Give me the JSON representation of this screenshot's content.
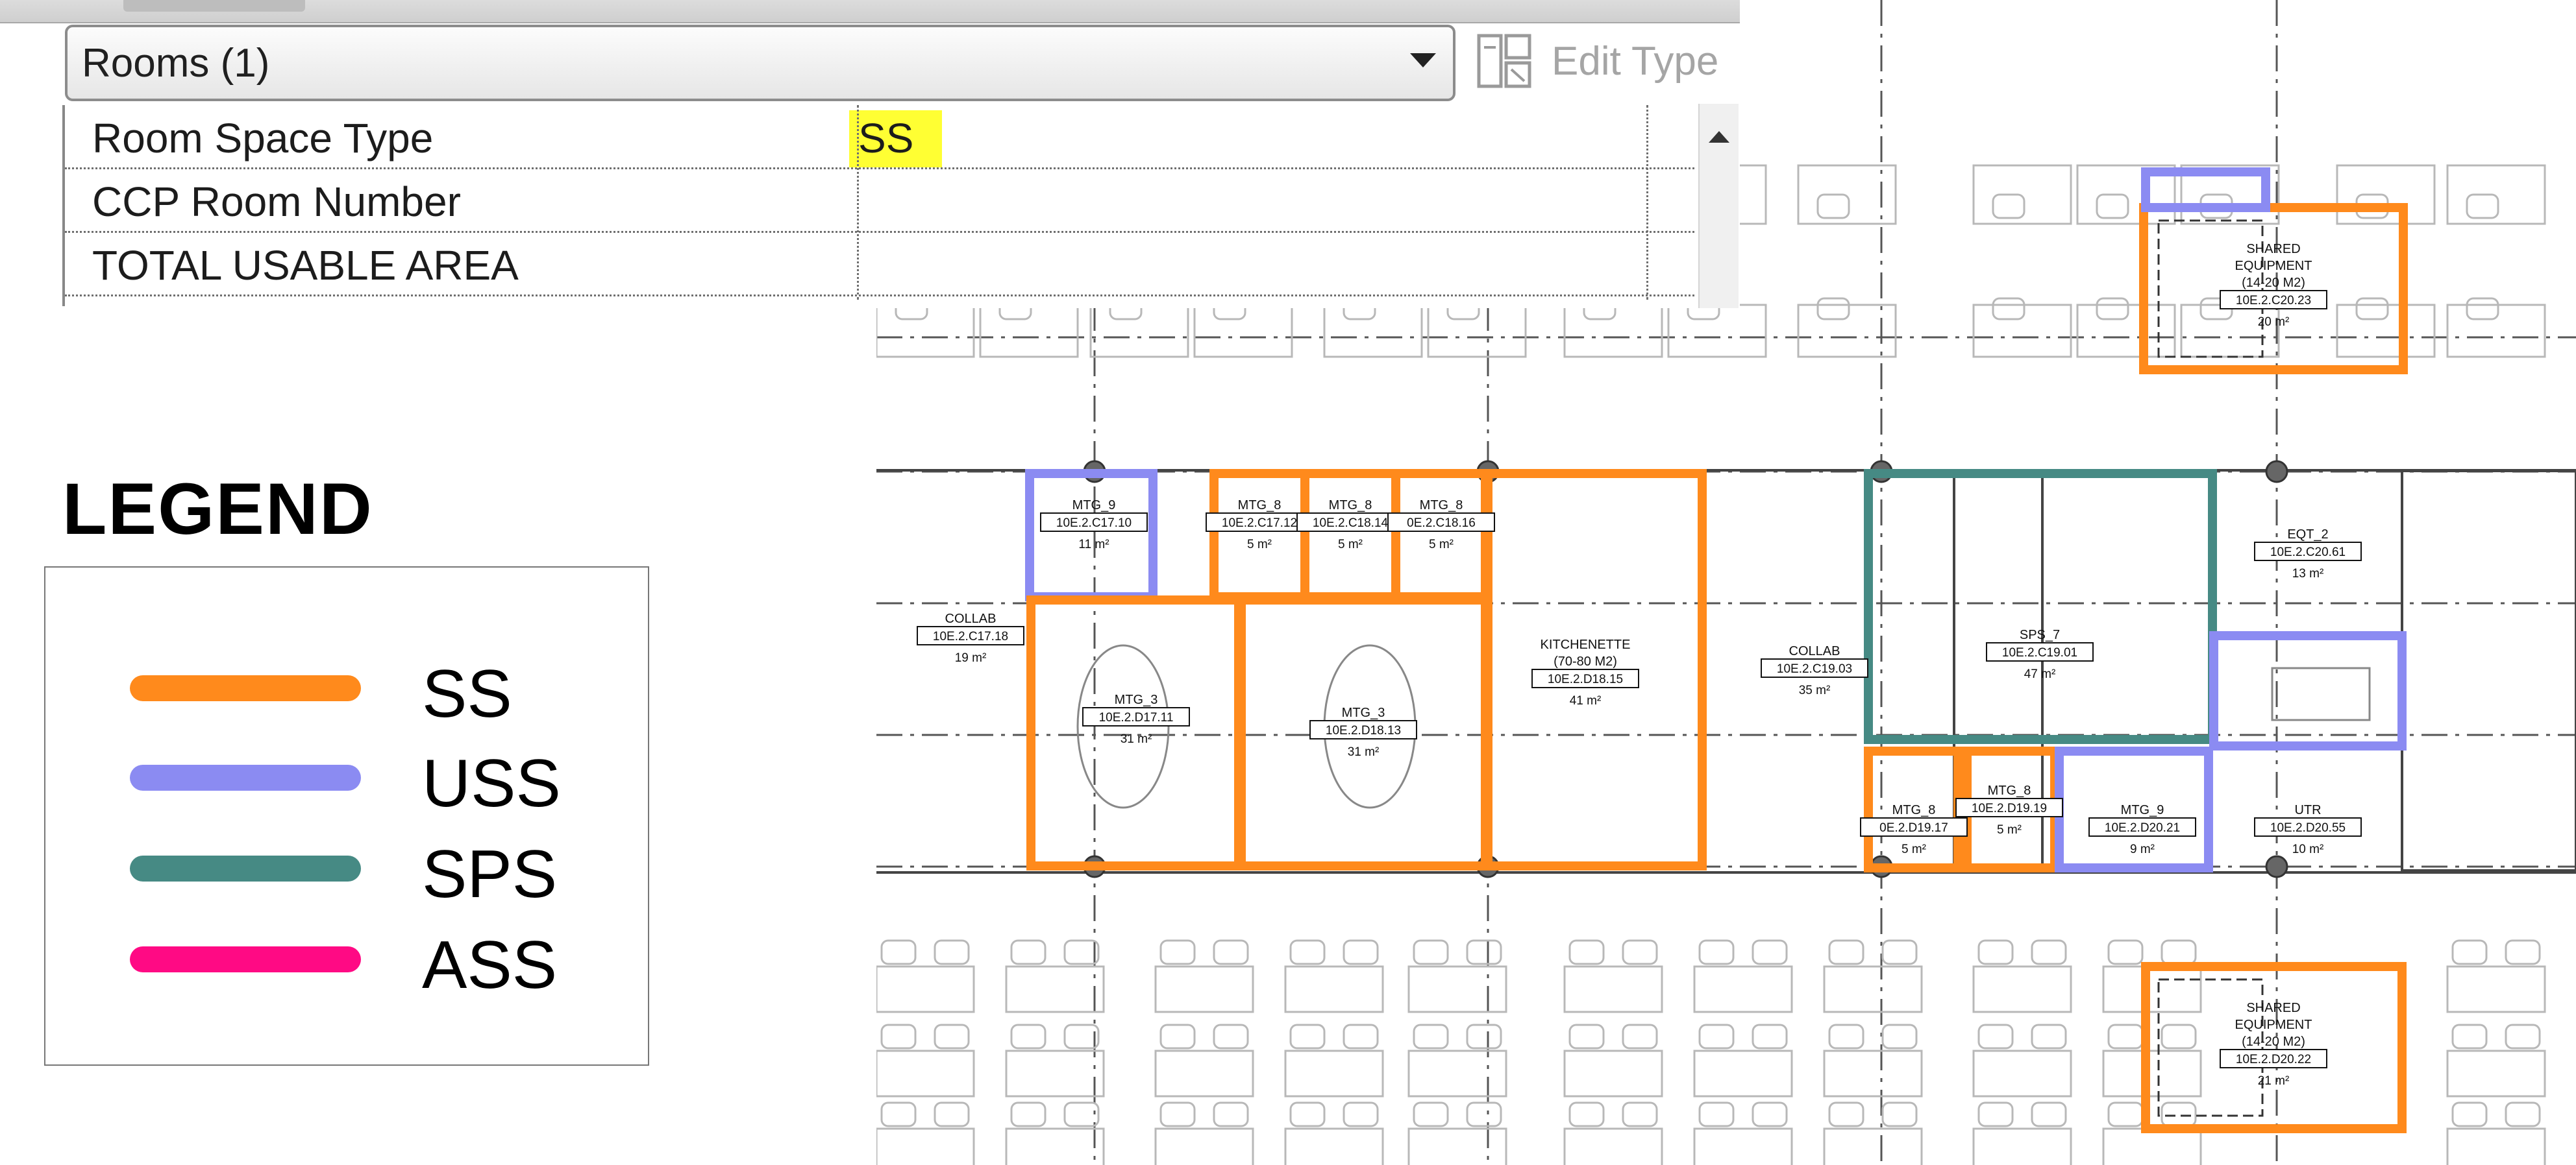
{
  "properties": {
    "type_selector": "Rooms (1)",
    "edit_type": "Edit Type",
    "rows": [
      {
        "name": "Room Space Type",
        "value": "SS"
      },
      {
        "name": "CCP Room Number",
        "value": ""
      },
      {
        "name": "TOTAL USABLE AREA",
        "value": ""
      }
    ]
  },
  "legend": {
    "title": "LEGEND",
    "items": [
      {
        "label": "SS",
        "color": "#ff8a1c"
      },
      {
        "label": "USS",
        "color": "#8b8bf2"
      },
      {
        "label": "SPS",
        "color": "#468a84"
      },
      {
        "label": "ASS",
        "color": "#ff0a84"
      }
    ]
  },
  "plan": {
    "rooms": [
      {
        "name": "SHARED",
        "name2": "EQUIPMENT",
        "note": "(14-20 M2)",
        "number": "10E.2.C20.23",
        "area": "20 m²"
      },
      {
        "name": "MTG_9",
        "number": "10E.2.C17.10",
        "area": "11 m²"
      },
      {
        "name": "MTG_8",
        "number": "10E.2.C17.12",
        "area": "5 m²"
      },
      {
        "name": "MTG_8",
        "number": "10E.2.C18.14",
        "area": "5 m²"
      },
      {
        "name": "MTG_8",
        "number": "0E.2.C18.16",
        "area": "5 m²"
      },
      {
        "name": "COLLAB",
        "number": "10E.2.C17.18",
        "area": "19 m²"
      },
      {
        "name": "MTG_3",
        "number": "10E.2.D17.11",
        "area": "31 m²"
      },
      {
        "name": "MTG_3",
        "number": "10E.2.D18.13",
        "area": "31 m²"
      },
      {
        "name": "KITCHENETTE",
        "note": "(70-80 M2)",
        "number": "10E.2.D18.15",
        "area": "41 m²"
      },
      {
        "name": "COLLAB",
        "number": "10E.2.C19.03",
        "area": "35 m²"
      },
      {
        "name": "SPS_7",
        "number": "10E.2.C19.01",
        "area": "47 m²"
      },
      {
        "name": "EQT_2",
        "number": "10E.2.C20.61",
        "area": "13 m²"
      },
      {
        "name": "MTG_8",
        "number": "0E.2.D19.17",
        "area": "5 m²"
      },
      {
        "name": "MTG_8",
        "number": "10E.2.D19.19",
        "area": "5 m²"
      },
      {
        "name": "MTG_9",
        "number": "10E.2.D20.21",
        "area": "9 m²"
      },
      {
        "name": "UTR",
        "number": "10E.2.D20.55",
        "area": "10 m²"
      },
      {
        "name": "SHARED",
        "name2": "EQUIPMENT",
        "note": "(14-20 M2)",
        "number": "10E.2.D20.22",
        "area": "21 m²"
      }
    ]
  }
}
